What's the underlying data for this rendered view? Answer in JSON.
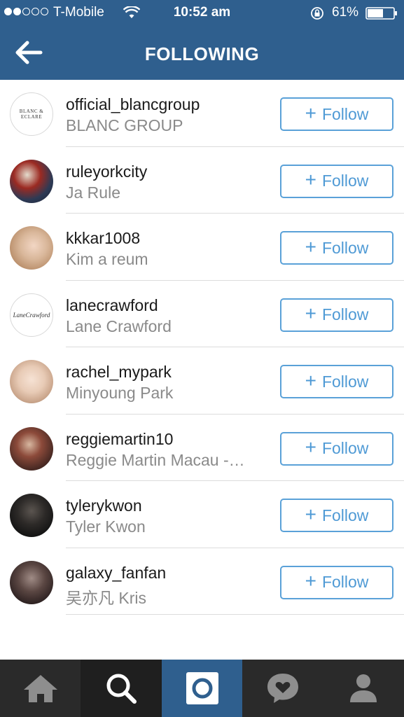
{
  "status_bar": {
    "carrier": "T-Mobile",
    "time": "10:52 am",
    "battery": "61%",
    "signal_bars_filled": 2,
    "signal_bars_total": 5,
    "battery_level": 0.61
  },
  "header": {
    "title": "FOLLOWING",
    "back_icon": "back-arrow-icon"
  },
  "colors": {
    "header_bg": "#2f5f8e",
    "follow_blue": "#4f9ad5",
    "tab_active_bg": "#2f5f8e"
  },
  "users": [
    {
      "username": "official_blancgroup",
      "full_name": "BLANC GROUP",
      "button_label": "Follow",
      "avatar_logo": "BLANC & ECLARE"
    },
    {
      "username": "ruleyorkcity",
      "full_name": "Ja Rule",
      "button_label": "Follow"
    },
    {
      "username": "kkkar1008",
      "full_name": "Kim a reum",
      "button_label": "Follow"
    },
    {
      "username": "lanecrawford",
      "full_name": "Lane Crawford",
      "button_label": "Follow",
      "avatar_logo": "LaneCrawford"
    },
    {
      "username": "rachel_mypark",
      "full_name": "Minyoung Park",
      "button_label": "Follow"
    },
    {
      "username": "reggiemartin10",
      "full_name": "Reggie Martin Macau -…",
      "button_label": "Follow"
    },
    {
      "username": "tylerykwon",
      "full_name": "Tyler Kwon",
      "button_label": "Follow"
    },
    {
      "username": "galaxy_fanfan",
      "full_name": "吴亦凡 Kris",
      "button_label": "Follow"
    }
  ],
  "tab_bar": {
    "tabs": [
      {
        "icon": "home-icon"
      },
      {
        "icon": "search-icon"
      },
      {
        "icon": "camera-icon"
      },
      {
        "icon": "activity-heart-icon"
      },
      {
        "icon": "profile-icon"
      }
    ]
  }
}
